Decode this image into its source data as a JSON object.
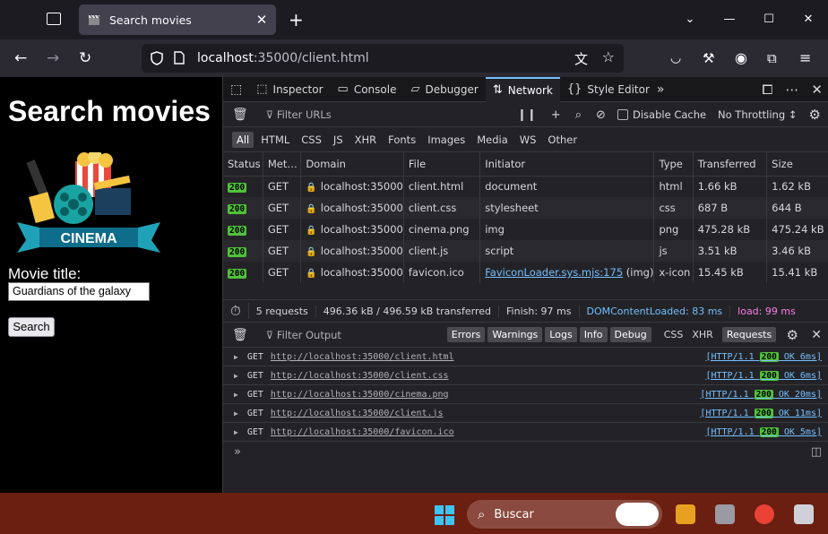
{
  "browser": {
    "tab_title": "Search movies",
    "url_host": "localhost",
    "url_rest": ":35000/client.html"
  },
  "page": {
    "heading": "Search movies",
    "image_text": "CINEMA",
    "label": "Movie title:",
    "input_value": "Guardians of the galaxy",
    "button": "Search"
  },
  "devtools": {
    "tabs": [
      "Inspector",
      "Console",
      "Debugger",
      "Network",
      "Style Editor"
    ],
    "filter_placeholder": "Filter URLs",
    "disable_cache": "Disable Cache",
    "throttling": "No Throttling ↕",
    "types": [
      "All",
      "HTML",
      "CSS",
      "JS",
      "XHR",
      "Fonts",
      "Images",
      "Media",
      "WS",
      "Other"
    ],
    "columns": [
      "Status",
      "Met…",
      "Domain",
      "File",
      "Initiator",
      "Type",
      "Transferred",
      "Size"
    ],
    "rows": [
      {
        "status": "200",
        "method": "GET",
        "domain": "localhost:35000",
        "file": "client.html",
        "initiator": "document",
        "initiator_suffix": "",
        "type": "html",
        "transferred": "1.66 kB",
        "size": "1.62 kB"
      },
      {
        "status": "200",
        "method": "GET",
        "domain": "localhost:35000",
        "file": "client.css",
        "initiator": "stylesheet",
        "initiator_suffix": "",
        "type": "css",
        "transferred": "687 B",
        "size": "644 B"
      },
      {
        "status": "200",
        "method": "GET",
        "domain": "localhost:35000",
        "file": "cinema.png",
        "initiator": "img",
        "initiator_suffix": "",
        "type": "png",
        "transferred": "475.28 kB",
        "size": "475.24 kB"
      },
      {
        "status": "200",
        "method": "GET",
        "domain": "localhost:35000",
        "file": "client.js",
        "initiator": "script",
        "initiator_suffix": "",
        "type": "js",
        "transferred": "3.51 kB",
        "size": "3.46 kB"
      },
      {
        "status": "200",
        "method": "GET",
        "domain": "localhost:35000",
        "file": "favicon.ico",
        "initiator": "FaviconLoader.sys.mjs:175",
        "initiator_suffix": " (img)",
        "type": "x-icon",
        "transferred": "15.45 kB",
        "size": "15.41 kB"
      }
    ],
    "summary": {
      "requests": "5 requests",
      "transferred": "496.36 kB / 496.59 kB transferred",
      "finish": "Finish: 97 ms",
      "dcl": "DOMContentLoaded: 83 ms",
      "load": "load: 99 ms"
    },
    "console": {
      "filter_placeholder": "Filter Output",
      "buttons": [
        "Errors",
        "Warnings",
        "Logs",
        "Info",
        "Debug"
      ],
      "plain": [
        "CSS",
        "XHR"
      ],
      "requests_btn": "Requests",
      "logs": [
        {
          "method": "GET",
          "url": "http://localhost:35000/client.html",
          "pre": "[HTTP/1.1 ",
          "code": "200",
          "post": " OK 6ms]"
        },
        {
          "method": "GET",
          "url": "http://localhost:35000/client.css",
          "pre": "[HTTP/1.1 ",
          "code": "200",
          "post": " OK 6ms]"
        },
        {
          "method": "GET",
          "url": "http://localhost:35000/cinema.png",
          "pre": "[HTTP/1.1 ",
          "code": "200",
          "post": " OK 20ms]"
        },
        {
          "method": "GET",
          "url": "http://localhost:35000/client.js",
          "pre": "[HTTP/1.1 ",
          "code": "200",
          "post": " OK 11ms]"
        },
        {
          "method": "GET",
          "url": "http://localhost:35000/favicon.ico",
          "pre": "[HTTP/1.1 ",
          "code": "200",
          "post": " OK 5ms]"
        }
      ]
    }
  },
  "taskbar": {
    "search": "Buscar"
  }
}
